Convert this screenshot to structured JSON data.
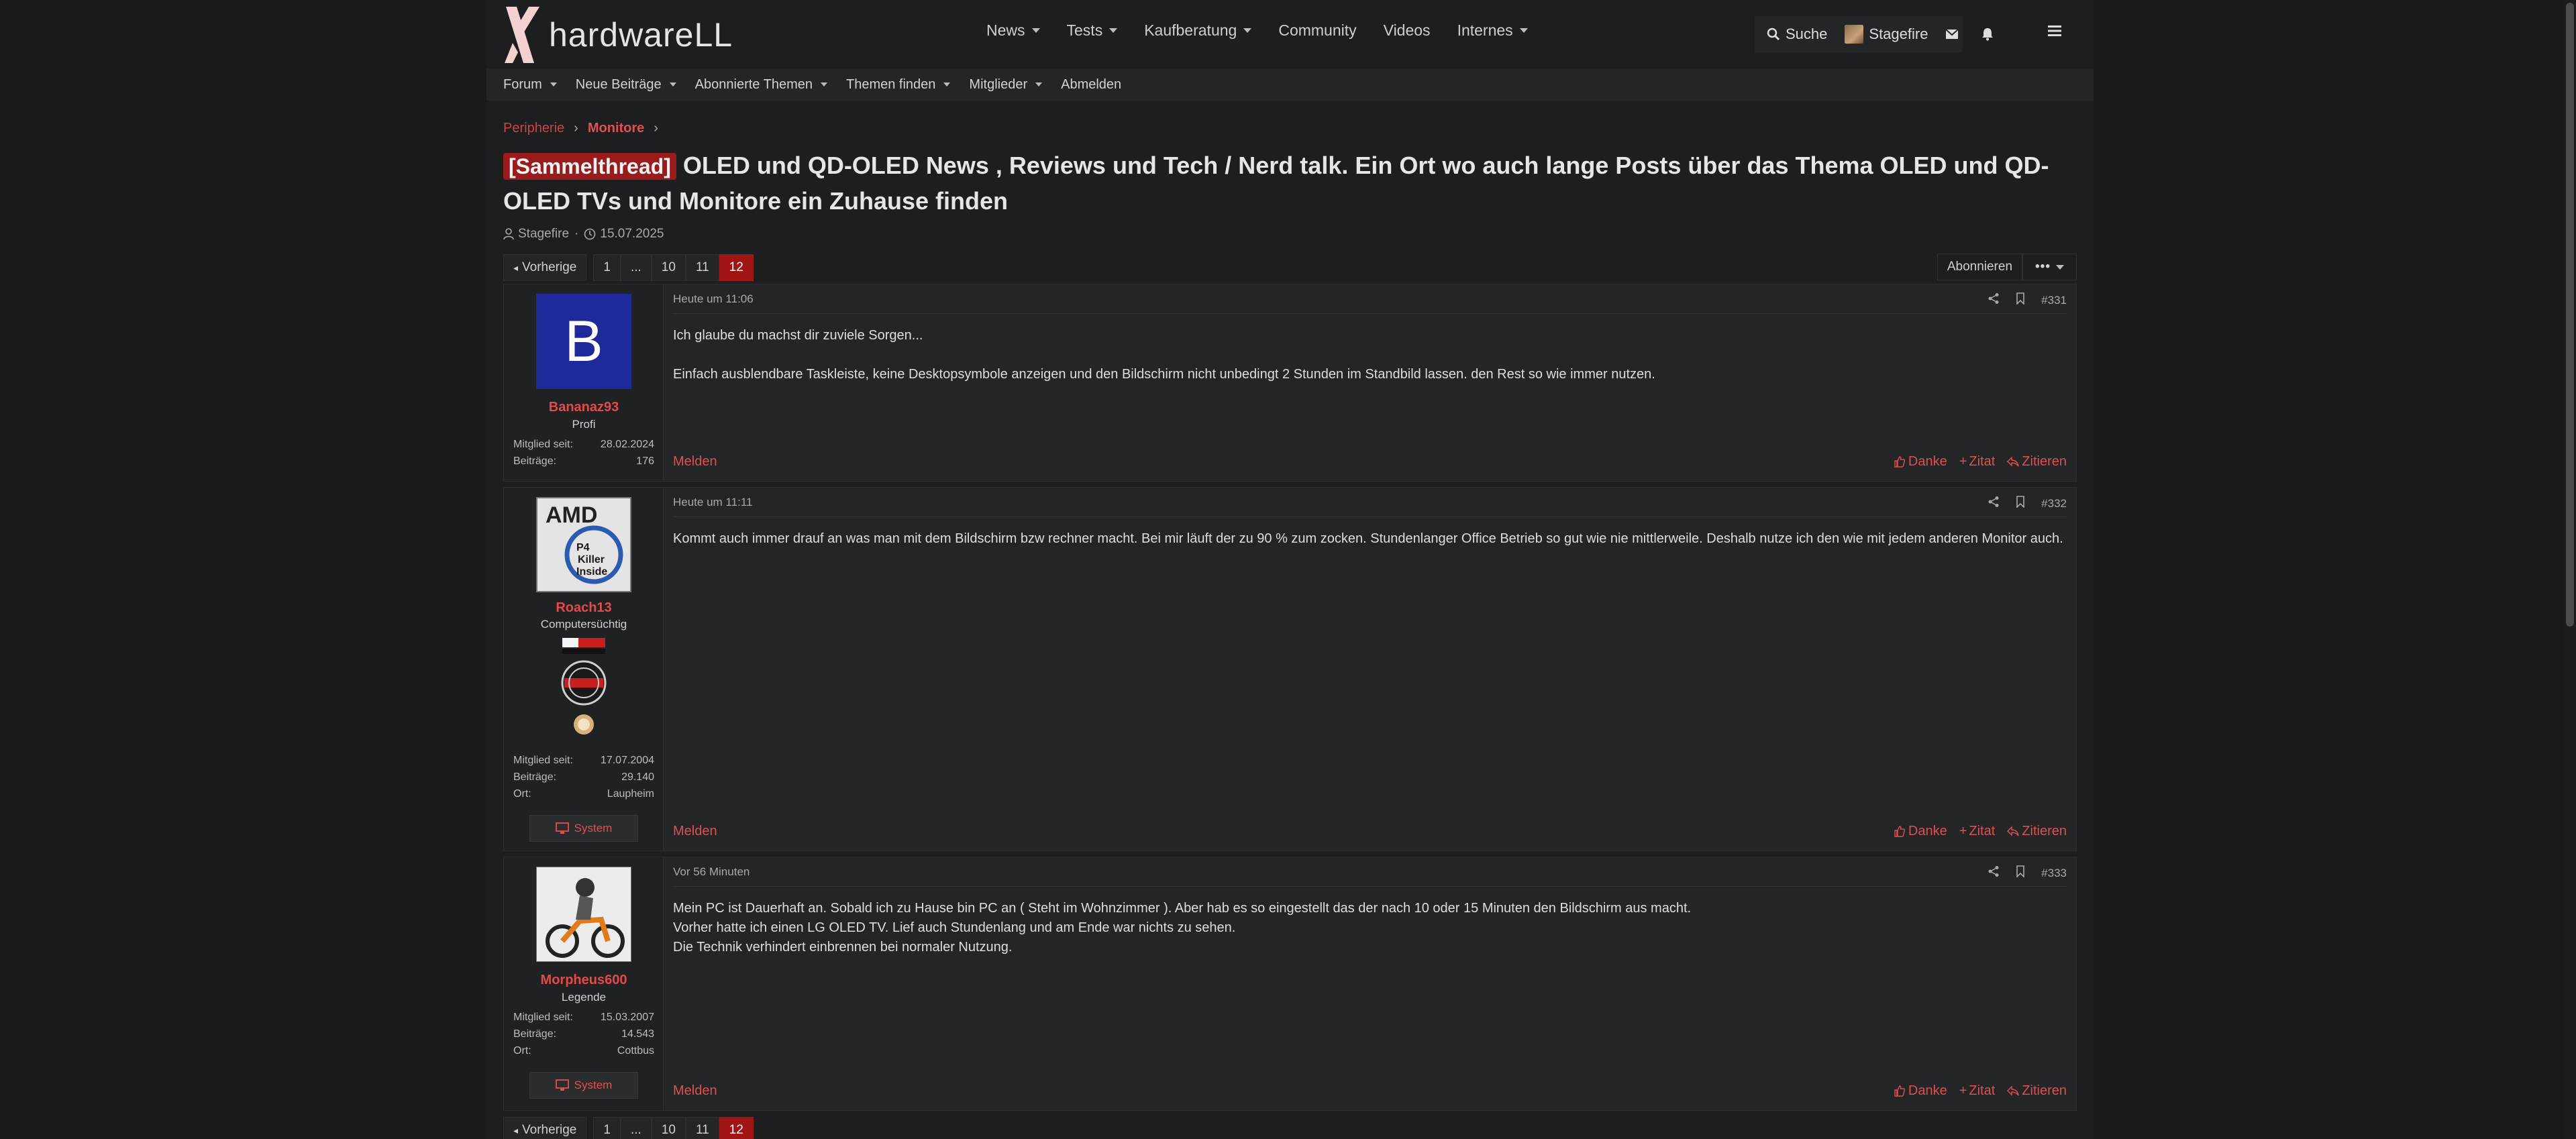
{
  "brand": {
    "logo_text": "hardwareLL"
  },
  "main_nav": [
    {
      "label": "News",
      "has_dropdown": true
    },
    {
      "label": "Tests",
      "has_dropdown": true
    },
    {
      "label": "Kaufberatung",
      "has_dropdown": true
    },
    {
      "label": "Community",
      "has_dropdown": false
    },
    {
      "label": "Videos",
      "has_dropdown": false
    },
    {
      "label": "Internes",
      "has_dropdown": true
    }
  ],
  "header_right": {
    "search_label": "Suche",
    "user_name": "Stagefire"
  },
  "sub_nav": [
    {
      "label": "Forum",
      "has_dropdown": true
    },
    {
      "label": "Neue Beiträge",
      "has_dropdown": true
    },
    {
      "label": "Abonnierte Themen",
      "has_dropdown": true
    },
    {
      "label": "Themen finden",
      "has_dropdown": true
    },
    {
      "label": "Mitglieder",
      "has_dropdown": true
    },
    {
      "label": "Abmelden",
      "has_dropdown": false
    }
  ],
  "breadcrumb": [
    "Peripherie",
    "Monitore"
  ],
  "thread": {
    "prefix": "[Sammelthread]",
    "title": "OLED und QD-OLED News , Reviews und Tech / Nerd talk. Ein Ort wo auch lange Posts über das Thema OLED und QD-OLED TVs und Monitore ein Zuhause finden",
    "author": "Stagefire",
    "date": "15.07.2025"
  },
  "pagination": {
    "prev_label": "Vorherige",
    "pages": [
      "1",
      "...",
      "10",
      "11",
      "12"
    ],
    "current": "12",
    "subscribe_label": "Abonnieren"
  },
  "posts": [
    {
      "user": "Bananaz93",
      "avatar_letter": "B",
      "rank": "Profi",
      "stats": [
        {
          "k": "Mitglied seit:",
          "v": "28.02.2024"
        },
        {
          "k": "Beiträge:",
          "v": "176"
        }
      ],
      "time": "Heute um 11:06",
      "number": "#331",
      "lines": [
        "Ich glaube du machst dir zuviele Sorgen...",
        "",
        "Einfach ausblendbare Taskleiste, keine Desktopsymbole anzeigen und den Bildschirm nicht unbedingt 2 Stunden im Standbild lassen. den Rest so wie immer nutzen."
      ]
    },
    {
      "user": "Roach13",
      "rank": "Computersüchtig",
      "stats": [
        {
          "k": "Mitglied seit:",
          "v": "17.07.2004"
        },
        {
          "k": "Beiträge:",
          "v": "29.140"
        },
        {
          "k": "Ort:",
          "v": "Laupheim"
        }
      ],
      "system_label": "System",
      "time": "Heute um 11:11",
      "number": "#332",
      "lines": [
        "Kommt auch immer drauf an was man mit dem Bildschirm bzw rechner macht. Bei mir läuft der zu 90 % zum zocken. Stundenlanger Office Betrieb so gut wie nie mittlerweile. Deshalb nutze ich den wie mit jedem anderen Monitor auch."
      ]
    },
    {
      "user": "Morpheus600",
      "rank": "Legende",
      "stats": [
        {
          "k": "Mitglied seit:",
          "v": "15.03.2007"
        },
        {
          "k": "Beiträge:",
          "v": "14.543"
        },
        {
          "k": "Ort:",
          "v": "Cottbus"
        }
      ],
      "system_label": "System",
      "time": "Vor 56 Minuten",
      "number": "#333",
      "lines": [
        "Mein PC ist Dauerhaft an. Sobald ich zu Hause bin PC an ( Steht im Wohnzimmer ). Aber hab es so eingestellt das der nach 10 oder 15 Minuten den Bildschirm aus macht.",
        "Vorher hatte ich einen LG OLED TV. Lief auch Stundenlang und am Ende war nichts zu sehen.",
        "Die Technik verhindert einbrennen bei normaler Nutzung."
      ]
    }
  ],
  "post_actions": {
    "report": "Melden",
    "thanks": "Danke",
    "quote": "Zitat",
    "reply": "Zitieren"
  },
  "colors": {
    "accent": "#e05050",
    "current_page": "#a11414",
    "prefix_bg": "#9a1b1b"
  }
}
